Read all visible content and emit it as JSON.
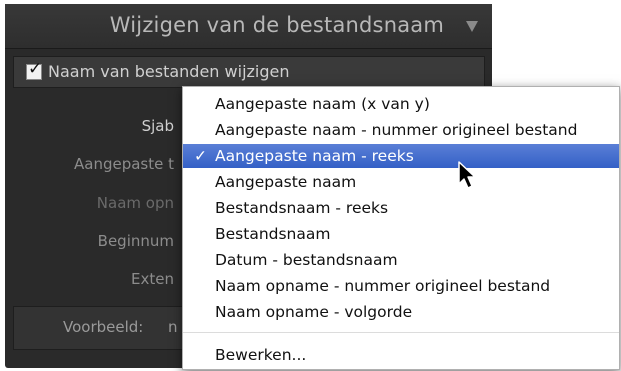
{
  "panel": {
    "title": "Wijzigen van de bestandsnaam",
    "rename_checkbox_label": "Naam van bestanden wijzigen",
    "rename_checked": true,
    "fields": [
      {
        "label": "Sjabloon",
        "visible": "Sjab"
      },
      {
        "label": "Aangepaste tekst",
        "visible": "Aangepaste t"
      },
      {
        "label": "Naam opname",
        "visible": "Naam opn"
      },
      {
        "label": "Beginnummer",
        "visible": "Beginnum"
      },
      {
        "label": "Extensies",
        "visible": "Exten"
      }
    ],
    "preview_label": "Voorbeeld:",
    "preview_value": "n"
  },
  "menu": {
    "items": [
      {
        "label": "Aangepaste naam (x van y)",
        "selected": false
      },
      {
        "label": "Aangepaste naam - nummer origineel bestand",
        "selected": false
      },
      {
        "label": "Aangepaste naam - reeks",
        "selected": true
      },
      {
        "label": "Aangepaste naam",
        "selected": false
      },
      {
        "label": "Bestandsnaam - reeks",
        "selected": false
      },
      {
        "label": "Bestandsnaam",
        "selected": false
      },
      {
        "label": "Datum - bestandsnaam",
        "selected": false
      },
      {
        "label": "Naam opname - nummer origineel bestand",
        "selected": false
      },
      {
        "label": "Naam opname - volgorde",
        "selected": false
      }
    ],
    "edit_label": "Bewerken...",
    "check_glyph": "✓"
  },
  "colors": {
    "panel_bg": "#2a2a2a",
    "highlight": "#3460c6"
  },
  "icons": {
    "collapse": "triangle-down-icon",
    "checkmark": "checkmark-icon",
    "cursor": "mouse-pointer-icon"
  }
}
